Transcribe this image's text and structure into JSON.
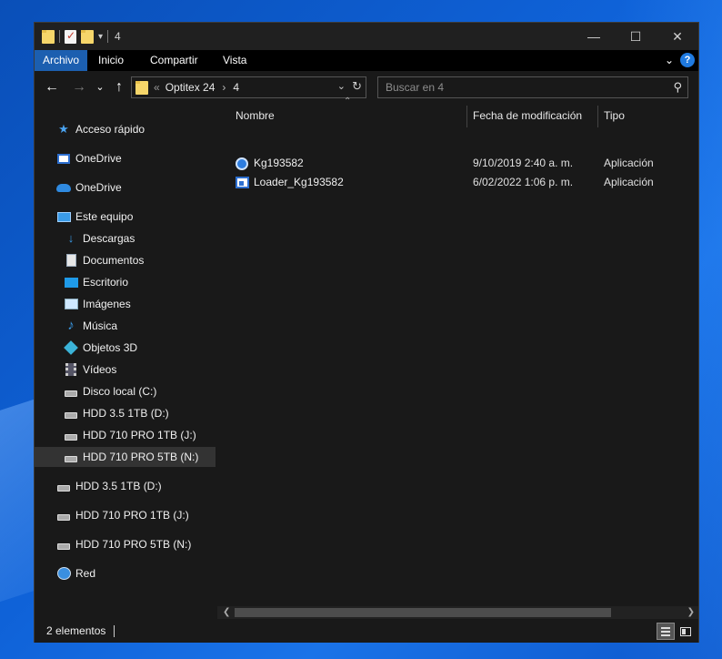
{
  "window": {
    "title": "4"
  },
  "ribbon": {
    "tabs": [
      {
        "label": "Archivo",
        "active": true
      },
      {
        "label": "Inicio"
      },
      {
        "label": "Compartir"
      },
      {
        "label": "Vista"
      }
    ],
    "help": "?"
  },
  "address": {
    "crumbs": [
      "Optitex 24",
      "4"
    ],
    "search_placeholder": "Buscar en 4"
  },
  "nav": {
    "quick_access": "Acceso rápido",
    "onedrive_business": "OneDrive",
    "onedrive_personal": "OneDrive",
    "this_pc": "Este equipo",
    "pc_items": [
      {
        "label": "Descargas"
      },
      {
        "label": "Documentos"
      },
      {
        "label": "Escritorio"
      },
      {
        "label": "Imágenes"
      },
      {
        "label": "Música"
      },
      {
        "label": "Objetos 3D"
      },
      {
        "label": "Vídeos"
      },
      {
        "label": "Disco local (C:)"
      },
      {
        "label": "HDD 3.5 1TB (D:)"
      },
      {
        "label": "HDD 710 PRO 1TB (J:)"
      },
      {
        "label": "HDD 710 PRO 5TB (N:)",
        "selected": true
      }
    ],
    "root_drives": [
      {
        "label": "HDD 3.5 1TB (D:)"
      },
      {
        "label": "HDD 710 PRO 1TB (J:)"
      },
      {
        "label": "HDD 710 PRO 5TB (N:)"
      }
    ],
    "network": "Red"
  },
  "columns": {
    "name": "Nombre",
    "modified": "Fecha de modificación",
    "type": "Tipo"
  },
  "files": [
    {
      "name": "Kg193582",
      "modified": "9/10/2019 2:40 a. m.",
      "type": "Aplicación",
      "icon": "app-disc-icon"
    },
    {
      "name": "Loader_Kg193582",
      "modified": "6/02/2022 1:06 p. m.",
      "type": "Aplicación",
      "icon": "app-window-icon"
    }
  ],
  "status": {
    "count": "2 elementos"
  },
  "colors": {
    "accent": "#1c5fb0",
    "background": "#191919",
    "desktop": "#0f62d8"
  }
}
